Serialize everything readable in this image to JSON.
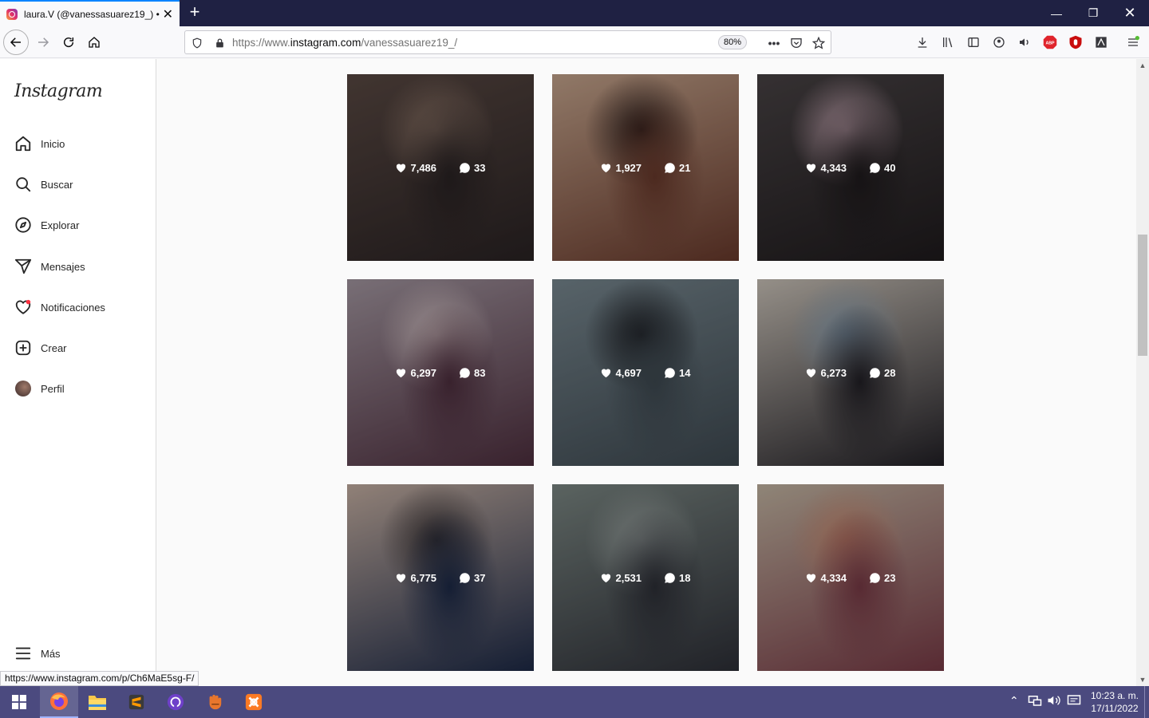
{
  "browser": {
    "tab_title": "laura.V (@vanessasuarez19_) • Instagram",
    "url_prefix": "https://www.",
    "url_domain": "instagram.com",
    "url_path": "/vanessasuarez19_/",
    "zoom": "80%",
    "status_url": "https://www.instagram.com/p/Ch6MaE5sg-F/"
  },
  "sidebar": {
    "logo": "Instagram",
    "items": [
      {
        "label": "Inicio",
        "icon": "home-icon"
      },
      {
        "label": "Buscar",
        "icon": "search-icon"
      },
      {
        "label": "Explorar",
        "icon": "compass-icon"
      },
      {
        "label": "Mensajes",
        "icon": "send-icon"
      },
      {
        "label": "Notificaciones",
        "icon": "heart-icon"
      },
      {
        "label": "Crear",
        "icon": "plus-square-icon"
      },
      {
        "label": "Perfil",
        "icon": "avatar"
      }
    ],
    "more": "Más"
  },
  "posts": [
    {
      "likes": "7,486",
      "comments": "33",
      "colors": [
        "#5b4a44",
        "#2a2324",
        "#8a7265"
      ]
    },
    {
      "likes": "1,927",
      "comments": "21",
      "colors": [
        "#c9a890",
        "#6a3a2c",
        "#2a1d1b"
      ]
    },
    {
      "likes": "4,343",
      "comments": "40",
      "colors": [
        "#4a4446",
        "#1f1b1d",
        "#c6a7b3"
      ]
    },
    {
      "likes": "6,297",
      "comments": "83",
      "colors": [
        "#a79aa4",
        "#4f2f3f",
        "#d5c4c6"
      ]
    },
    {
      "likes": "4,697",
      "comments": "14",
      "colors": [
        "#7a8a92",
        "#3f4a52",
        "#1c1d22"
      ]
    },
    {
      "likes": "6,273",
      "comments": "28",
      "colors": [
        "#cfc7bd",
        "#222026",
        "#8aa0b3"
      ]
    },
    {
      "likes": "6,775",
      "comments": "37",
      "colors": [
        "#c9b3a6",
        "#1d2a48",
        "#3a3334"
      ]
    },
    {
      "likes": "2,531",
      "comments": "18",
      "colors": [
        "#7e8a86",
        "#2e3038",
        "#9aa2a0"
      ]
    },
    {
      "likes": "4,334",
      "comments": "23",
      "colors": [
        "#c7b9a6",
        "#7a3b47",
        "#c98a70"
      ]
    }
  ],
  "taskbar": {
    "time": "10:23 a. m.",
    "date": "17/11/2022"
  }
}
